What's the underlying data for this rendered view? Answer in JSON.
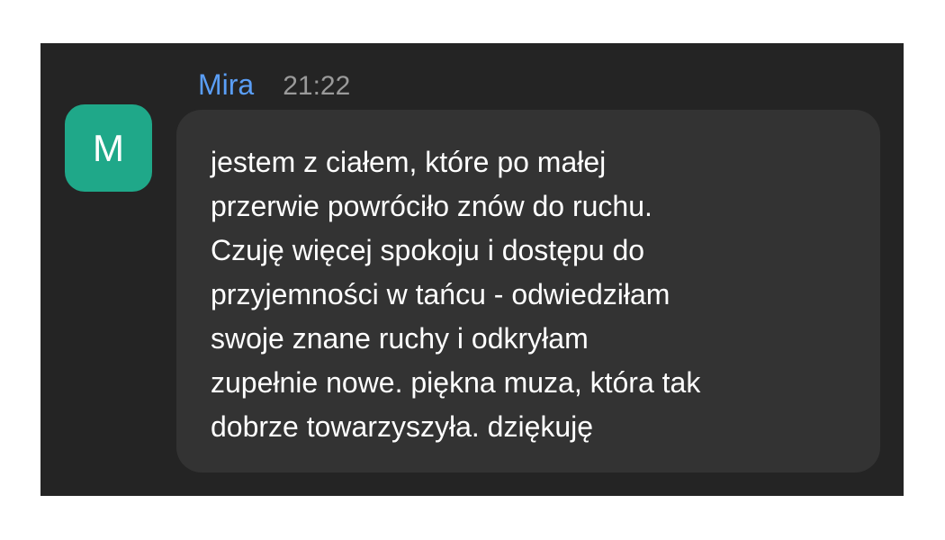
{
  "message": {
    "sender": "Mira",
    "time": "21:22",
    "avatar_initial": "M",
    "text": "jestem z ciałem, które po małej\nprzerwie powróciło znów do ruchu.\nCzuję więcej spokoju i dostępu do\nprzyjemności w tańcu - odwiedziłam\nswoje znane ruchy i odkryłam\nzupełnie nowe. piękna muza, która tak\ndobrze towarzyszyła. dziękuję"
  },
  "colors": {
    "background": "#242424",
    "bubble": "#333333",
    "sender_name": "#5a9ef6",
    "timestamp": "#9a9a9a",
    "avatar": "#1fa889",
    "text": "#ffffff"
  }
}
